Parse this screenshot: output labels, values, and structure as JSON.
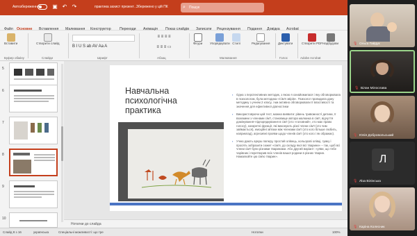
{
  "titlebar": {
    "autosave_label": "Автозбереження",
    "doc_title": "практика захист презент…",
    "save_state": "Збережено у цій ПК",
    "search_placeholder": "Пошук"
  },
  "menu": {
    "items": [
      "Файл",
      "Основне",
      "Вставлення",
      "Малювання",
      "Конструктор",
      "Переходи",
      "Анімація",
      "Показ слайдів",
      "Записати",
      "Рецензування",
      "Подання",
      "Довідка",
      "Acrobat"
    ],
    "active": "Основне",
    "record_label": "Записати"
  },
  "ribbon": {
    "buttons": [
      "Вставити",
      "Створити слайд",
      "Шрифт",
      "Абзац",
      "Фігури",
      "Упорядкувати",
      "Стилі",
      "Редагування",
      "Диктувати",
      "Створити PDF",
      "Надбудови"
    ],
    "groups": [
      "Буфер обміну",
      "Слайди",
      "Шрифт",
      "Абзац",
      "Малювання",
      "Голос",
      "Adobe Acrobat",
      "Надбудови"
    ]
  },
  "thumbnails": [
    {
      "num": "5"
    },
    {
      "num": "6"
    },
    {
      "num": "7"
    },
    {
      "num": "8"
    },
    {
      "num": "9"
    },
    {
      "num": "10"
    }
  ],
  "slide": {
    "title": "Навчальна психологічна практика",
    "bullets": [
      "Одна з перспективних методик, з якою я ознайомилася і яку обговорювала в психологом, була методика «Сім'я звірів». Психолог проводила дану методику з учнем 2 класу, і ми активно обговорювали її властивості та значення для ефективної діагностики",
      "Використовуючи цей тест, можна виявити: рівень тривожності дитини, її взаємини з членами сім'ї, становище автора малюнка в сім'ї, відчуття домінування–підпорядкування в сім'ї (хто «головний», хто має право голосу), конкретні функції, які виконують різні члени сім'ї (хто чим займається), емоційні зв'язки між членами сім'ї (хто кого більше любить, наприклад), агресивні прояви щодо членів сім'ї (хто кого і як ображає).",
      "Учню дають аркуш паперу, простий олівець, кольорові олівці, гумку і просять зобразити сюжет «сім'я, до складу якої всі тварини» – так, щоб всі члени сім'ї були різними тваринами. Або другий варіант: «уяви, що тебе чарівник і перетворив всіх членів вашої родини в різних тварин. Намалюйте цю сім'ю тварин»."
    ]
  },
  "notes_label": "Нотатки до слайда",
  "status": {
    "slide_info": "Слайд 8 з 16",
    "language": "українська",
    "accessibility": "Спеціальні можливості: що тре",
    "notes": "Нотатки",
    "zoom": "100%"
  },
  "participants": [
    {
      "name": "Ольга Гайдук",
      "muted": true
    },
    {
      "name": "Білан Мілослава",
      "muted": true
    },
    {
      "name": "Юлія Добровольський",
      "muted": true
    },
    {
      "name": "Ліза Вілінська",
      "muted": true,
      "initial": "Л"
    },
    {
      "name": "Каріна Колесник",
      "muted": true
    }
  ],
  "colors": {
    "accent": "#c43e1c",
    "slide_accent": "#4a74c4",
    "active_speaker": "#9bd48a"
  }
}
